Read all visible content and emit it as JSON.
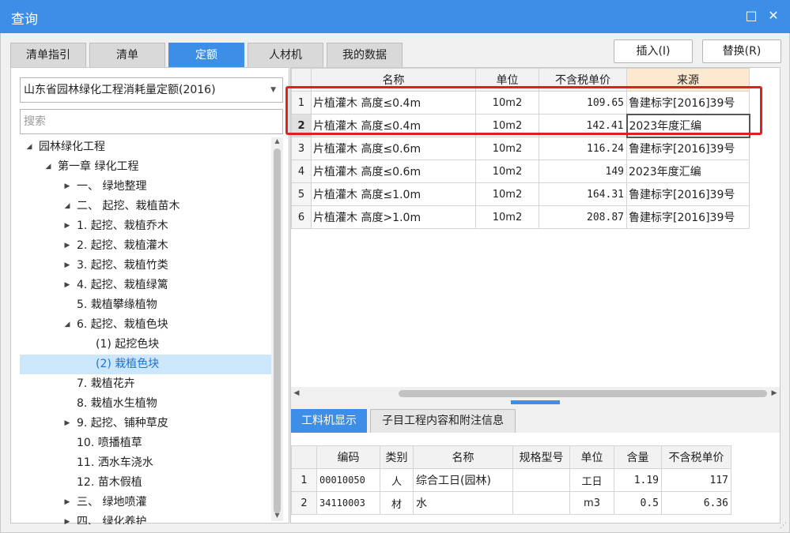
{
  "window": {
    "title": "查询",
    "restore_glyph": "□",
    "close_glyph": "✕"
  },
  "tabs": [
    {
      "label": "清单指引",
      "active": false
    },
    {
      "label": "清单",
      "active": false
    },
    {
      "label": "定额",
      "active": true
    },
    {
      "label": "人材机",
      "active": false
    },
    {
      "label": "我的数据",
      "active": false
    }
  ],
  "buttons": {
    "insert": "插入(I)",
    "replace": "替换(R)"
  },
  "library": {
    "selected": "山东省园林绿化工程消耗量定额(2016)"
  },
  "search": {
    "placeholder": "搜索"
  },
  "tree": [
    {
      "label": "园林绿化工程",
      "arrow": "◢",
      "selected": false
    },
    {
      "label": "第一章 绿化工程",
      "arrow": "◢",
      "selected": false
    },
    {
      "label": "一、 绿地整理",
      "arrow": "▶",
      "selected": false
    },
    {
      "label": "二、 起挖、栽植苗木",
      "arrow": "◢",
      "selected": false
    },
    {
      "label": "1. 起挖、栽植乔木",
      "arrow": "▶",
      "selected": false
    },
    {
      "label": "2. 起挖、栽植灌木",
      "arrow": "▶",
      "selected": false
    },
    {
      "label": "3. 起挖、栽植竹类",
      "arrow": "▶",
      "selected": false
    },
    {
      "label": "4. 起挖、栽植绿篱",
      "arrow": "▶",
      "selected": false
    },
    {
      "label": "5. 栽植攀缘植物",
      "arrow": "",
      "selected": false
    },
    {
      "label": "6. 起挖、栽植色块",
      "arrow": "◢",
      "selected": false
    },
    {
      "label": "(1) 起挖色块",
      "arrow": "",
      "selected": false
    },
    {
      "label": "(2) 栽植色块",
      "arrow": "",
      "selected": true
    },
    {
      "label": "7. 栽植花卉",
      "arrow": "",
      "selected": false
    },
    {
      "label": "8. 栽植水生植物",
      "arrow": "",
      "selected": false
    },
    {
      "label": "9. 起挖、铺种草皮",
      "arrow": "▶",
      "selected": false
    },
    {
      "label": "10. 喷播植草",
      "arrow": "",
      "selected": false
    },
    {
      "label": "11. 洒水车浇水",
      "arrow": "",
      "selected": false
    },
    {
      "label": "12. 苗木假植",
      "arrow": "",
      "selected": false
    },
    {
      "label": "三、 绿地喷灌",
      "arrow": "▶",
      "selected": false
    },
    {
      "label": "四、 绿化养护",
      "arrow": "▶",
      "selected": false
    }
  ],
  "quota_table": {
    "headers": [
      "",
      "名称",
      "单位",
      "不含税单价",
      "来源"
    ],
    "rows": [
      {
        "no": "1",
        "name": "片植灌木 高度≤0.4m",
        "unit": "10m2",
        "price": "109.65",
        "source": "鲁建标字[2016]39号"
      },
      {
        "no": "2",
        "name": "片植灌木 高度≤0.4m",
        "unit": "10m2",
        "price": "142.41",
        "source": "2023年度汇编"
      },
      {
        "no": "3",
        "name": "片植灌木 高度≤0.6m",
        "unit": "10m2",
        "price": "116.24",
        "source": "鲁建标字[2016]39号"
      },
      {
        "no": "4",
        "name": "片植灌木 高度≤0.6m",
        "unit": "10m2",
        "price": "149",
        "source": "2023年度汇编"
      },
      {
        "no": "5",
        "name": "片植灌木 高度≤1.0m",
        "unit": "10m2",
        "price": "164.31",
        "source": "鲁建标字[2016]39号"
      },
      {
        "no": "6",
        "name": "片植灌木 高度>1.0m",
        "unit": "10m2",
        "price": "208.87",
        "source": "鲁建标字[2016]39号"
      }
    ]
  },
  "bottom_tabs": [
    {
      "label": "工料机显示",
      "active": true
    },
    {
      "label": "子目工程内容和附注信息",
      "active": false
    }
  ],
  "material_table": {
    "headers": [
      "",
      "编码",
      "类别",
      "名称",
      "规格型号",
      "单位",
      "含量",
      "不含税单价"
    ],
    "rows": [
      {
        "no": "1",
        "code": "00010050",
        "type": "人",
        "name": "综合工日(园林)",
        "spec": "",
        "unit": "工日",
        "qty": "1.19",
        "price": "117"
      },
      {
        "no": "2",
        "code": "34110003",
        "type": "材",
        "name": "水",
        "spec": "",
        "unit": "m3",
        "qty": "0.5",
        "price": "6.36"
      }
    ]
  },
  "colors": {
    "accent": "#3d8ee6",
    "highlight": "#e02020",
    "source_header": "#fde9cf"
  }
}
